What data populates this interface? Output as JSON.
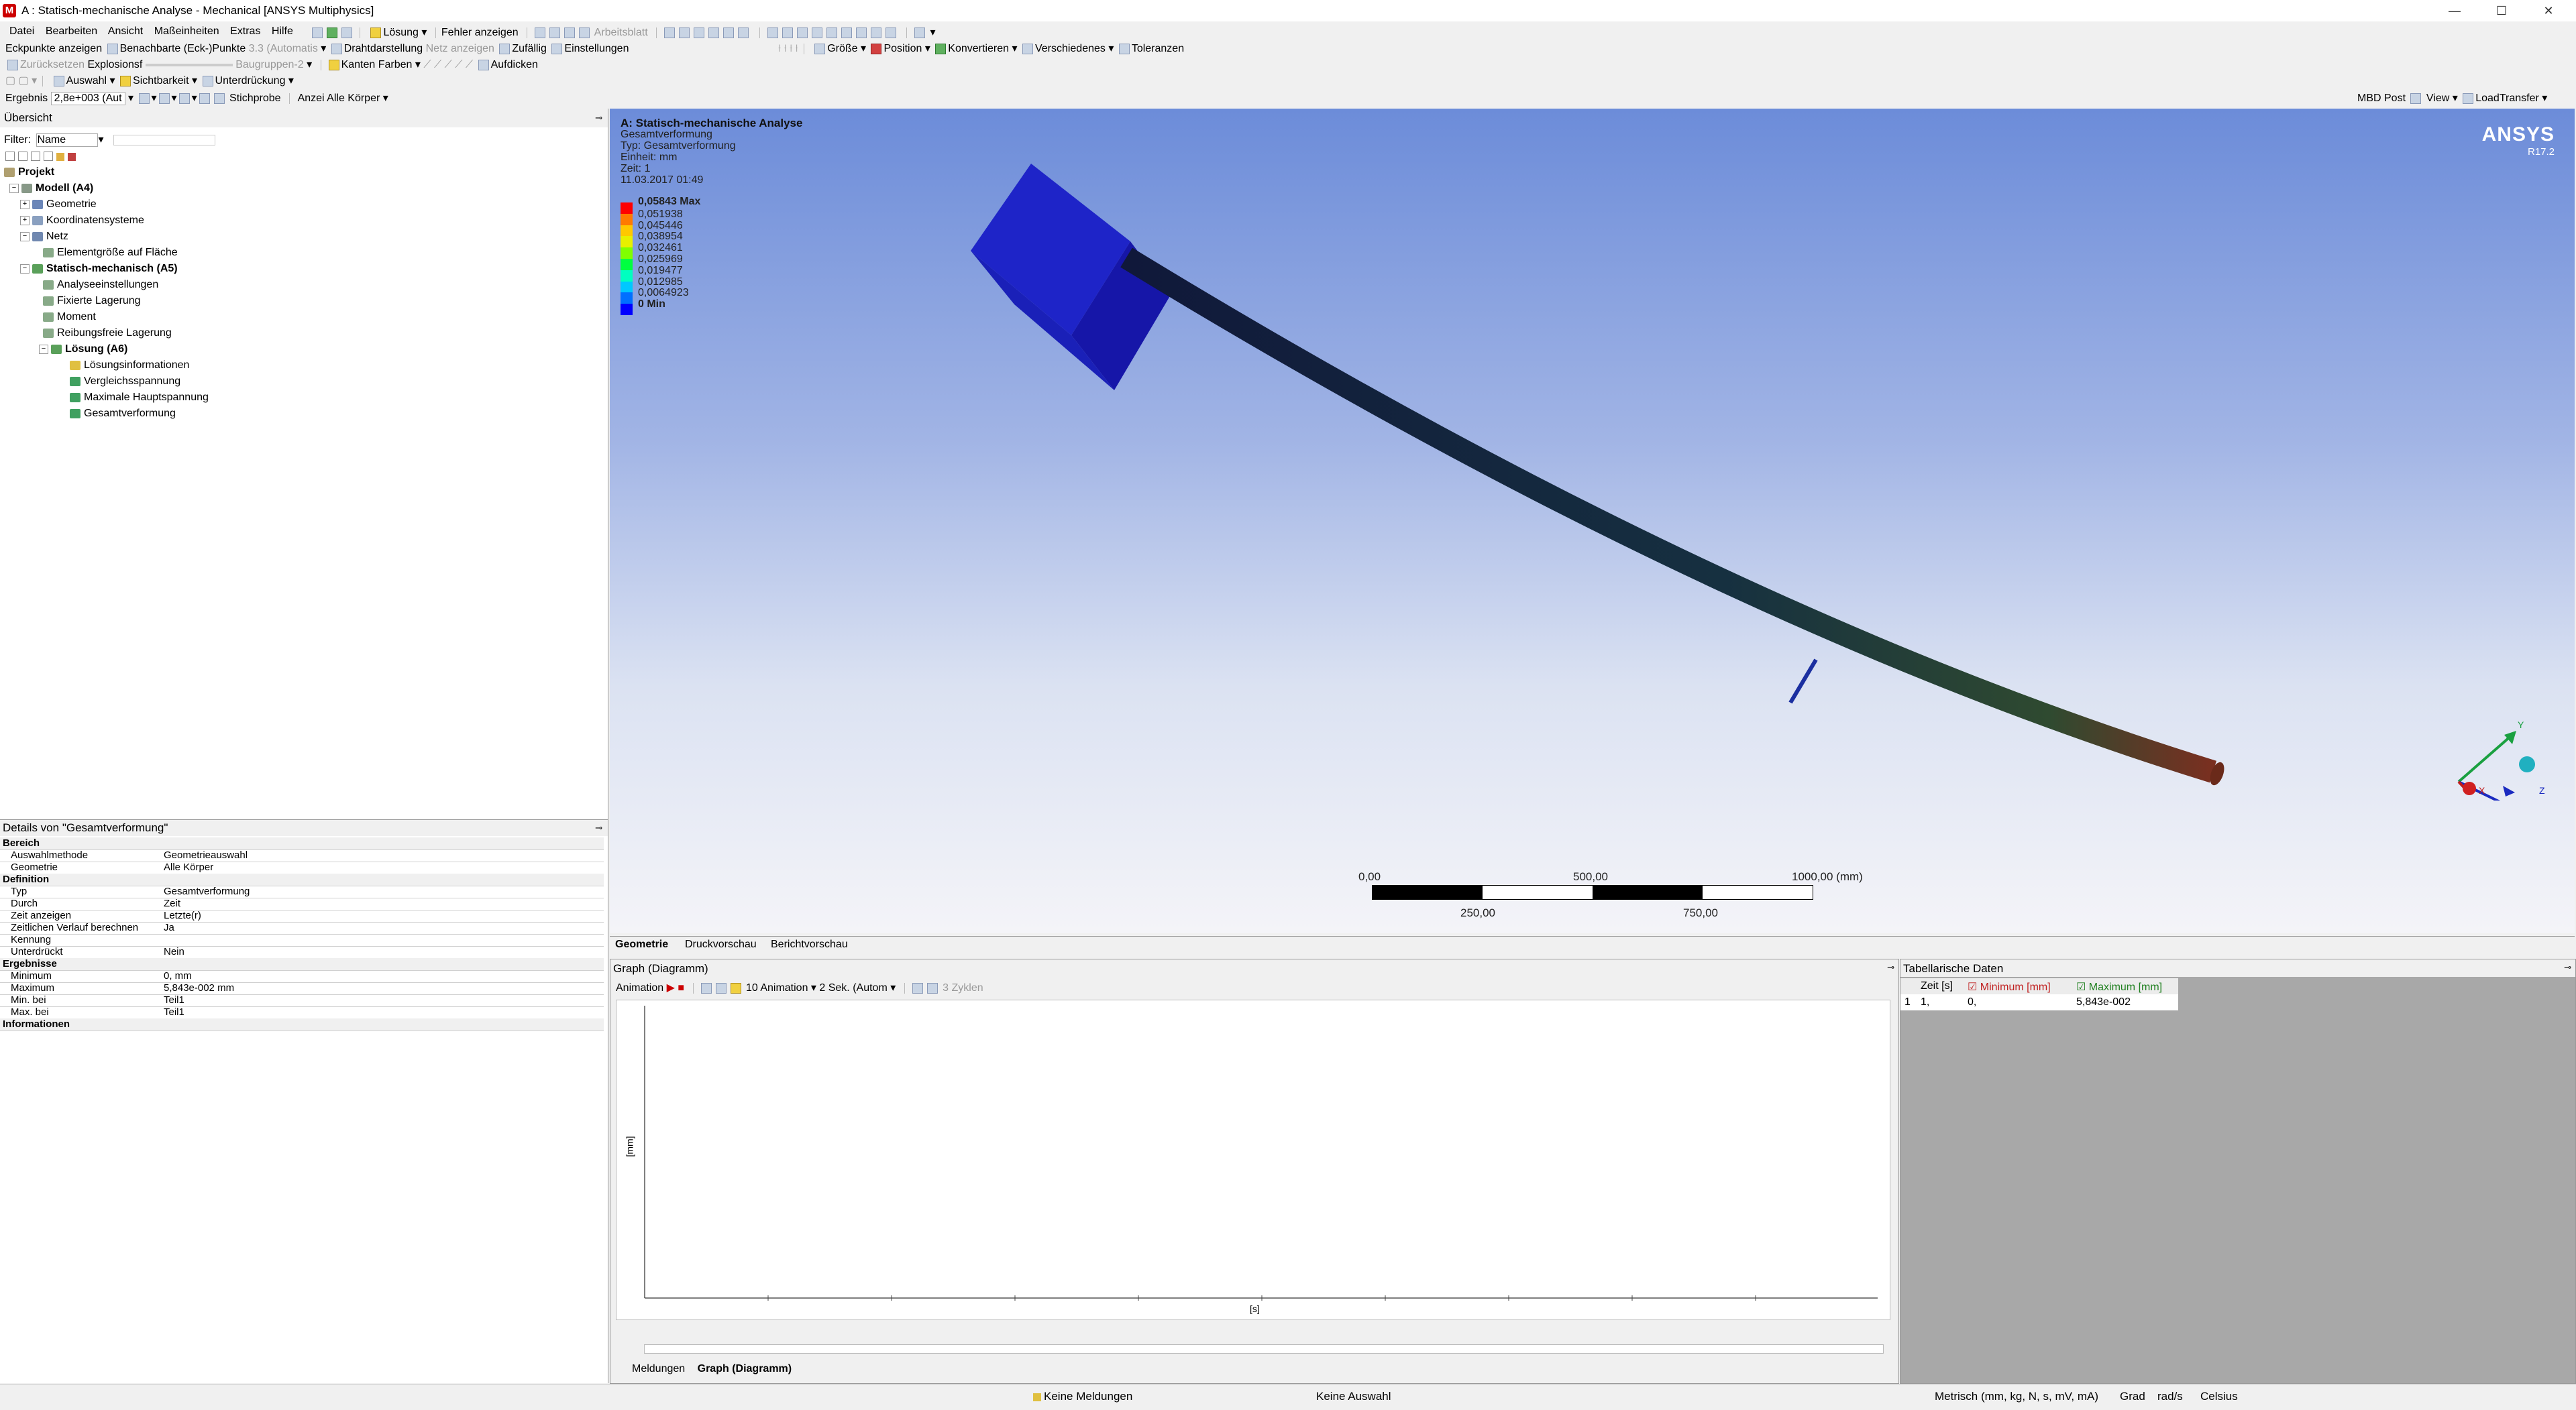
{
  "window": {
    "title": "A : Statisch-mechanische Analyse - Mechanical [ANSYS Multiphysics]",
    "app_icon": "M",
    "controls": [
      "—",
      "☐",
      "✕"
    ]
  },
  "menu": [
    "Datei",
    "Bearbeiten",
    "Ansicht",
    "Maßeinheiten",
    "Extras",
    "Hilfe"
  ],
  "toolbar1": {
    "solve": "Lösung",
    "errors": "Fehler anzeigen",
    "worksheet": "Arbeitsblatt"
  },
  "toolbar1_right": {
    "size": "Größe",
    "position": "Position",
    "convert": "Konvertieren",
    "misc": "Verschiedenes",
    "tolerances": "Toleranzen"
  },
  "toolbar2": {
    "show_vertices": "Eckpunkte anzeigen",
    "adjacent": "Benachbarte (Eck-)Punkte",
    "auto": "3.3 (Automatis",
    "wireframe": "Drahtdarstellung",
    "show_mesh": "Netz anzeigen",
    "random": "Zufällig",
    "settings": "Einstellungen"
  },
  "toolbar3": {
    "reset": "Zurücksetzen",
    "explosion": "Explosionsf",
    "assembly": "Baugruppen-2",
    "edge_colors": "Kanten Farben",
    "thicken": "Aufdicken"
  },
  "toolbar4": {
    "selection": "Auswahl",
    "visibility": "Sichtbarkeit",
    "suppression": "Unterdrückung"
  },
  "result_bar": {
    "result_label": "Ergebnis",
    "scale": "2,8e+003 (Aut",
    "probe": "Stichprobe",
    "display_label": "Anzei",
    "display_value": "Alle Körper",
    "mbd_post": "MBD Post",
    "view": "View",
    "load_transfer": "LoadTransfer"
  },
  "outline": {
    "title": "Übersicht",
    "filter_label": "Filter:",
    "filter_value": "Name",
    "items": [
      {
        "label": "Projekt",
        "bold": true
      },
      {
        "label": "Modell (A4)",
        "bold": true
      },
      {
        "label": "Geometrie"
      },
      {
        "label": "Koordinatensysteme"
      },
      {
        "label": "Netz"
      },
      {
        "label": "Elementgröße auf Fläche"
      },
      {
        "label": "Statisch-mechanisch (A5)",
        "bold": true
      },
      {
        "label": "Analyseeinstellungen"
      },
      {
        "label": "Fixierte Lagerung"
      },
      {
        "label": "Moment"
      },
      {
        "label": "Reibungsfreie Lagerung"
      },
      {
        "label": "Lösung (A6)",
        "bold": true
      },
      {
        "label": "Lösungsinformationen"
      },
      {
        "label": "Vergleichsspannung"
      },
      {
        "label": "Maximale Hauptspannung"
      },
      {
        "label": "Gesamtverformung"
      }
    ]
  },
  "details": {
    "title": "Details von \"Gesamtverformung\"",
    "rows": [
      {
        "k": "Bereich",
        "v": "",
        "group": true
      },
      {
        "k": "Auswahlmethode",
        "v": "Geometrieauswahl"
      },
      {
        "k": "Geometrie",
        "v": "Alle Körper"
      },
      {
        "k": "Definition",
        "v": "",
        "group": true
      },
      {
        "k": "Typ",
        "v": "Gesamtverformung"
      },
      {
        "k": "Durch",
        "v": "Zeit"
      },
      {
        "k": "Zeit anzeigen",
        "v": "Letzte(r)"
      },
      {
        "k": "Zeitlichen Verlauf berechnen",
        "v": "Ja"
      },
      {
        "k": "Kennung",
        "v": ""
      },
      {
        "k": "Unterdrückt",
        "v": "Nein"
      },
      {
        "k": "Ergebnisse",
        "v": "",
        "group": true
      },
      {
        "k": "Minimum",
        "v": "0, mm"
      },
      {
        "k": "Maximum",
        "v": "5,843e-002 mm"
      },
      {
        "k": "Min. bei",
        "v": "Teil1"
      },
      {
        "k": "Max. bei",
        "v": "Teil1"
      },
      {
        "k": "Informationen",
        "v": "",
        "group": true
      }
    ]
  },
  "viewport": {
    "header": "A: Statisch-mechanische Analyse",
    "info": [
      "Gesamtverformung",
      "Typ: Gesamtverformung",
      "Einheit: mm",
      "Zeit: 1",
      "11.03.2017 01:49"
    ],
    "legend": {
      "max_label": "0,05843 Max",
      "values": [
        "0,051938",
        "0,045446",
        "0,038954",
        "0,032461",
        "0,025969",
        "0,019477",
        "0,012985",
        "0,0064923"
      ],
      "min_label": "0 Min",
      "colors": [
        "#ff0000",
        "#ff7a00",
        "#ffc800",
        "#e8f000",
        "#80ff00",
        "#00ff40",
        "#00ffc0",
        "#00c8ff",
        "#0070ff",
        "#0000ff"
      ]
    },
    "logo": "ANSYS",
    "version": "R17.2",
    "scale": {
      "t0": "0,00",
      "t1": "500,00",
      "t2": "1000,00 (mm)",
      "b1": "250,00",
      "b2": "750,00"
    },
    "triad": {
      "x": "X",
      "y": "Y",
      "z": "Z"
    }
  },
  "view_tabs": [
    "Geometrie",
    "Druckvorschau",
    "Berichtvorschau"
  ],
  "graph": {
    "title": "Graph (Diagramm)",
    "animation": "Animation",
    "frames": "10 Animation",
    "duration": "2 Sek. (Autom",
    "cycles": "3 Zyklen",
    "y_label": "[mm]",
    "x_label": "[s]"
  },
  "bottom_tabs": [
    "Meldungen",
    "Graph (Diagramm)"
  ],
  "table": {
    "title": "Tabellarische Daten",
    "headers": [
      "",
      "Zeit [s]",
      "Minimum [mm]",
      "Maximum [mm]"
    ],
    "rows": [
      [
        "1",
        "1,",
        "0,",
        "5,843e-002"
      ]
    ]
  },
  "status": {
    "messages": "Keine Meldungen",
    "selection": "Keine Auswahl",
    "units": "Metrisch (mm, kg, N, s, mV, mA)",
    "angle": "Grad",
    "rot": "rad/s",
    "temp": "Celsius"
  }
}
